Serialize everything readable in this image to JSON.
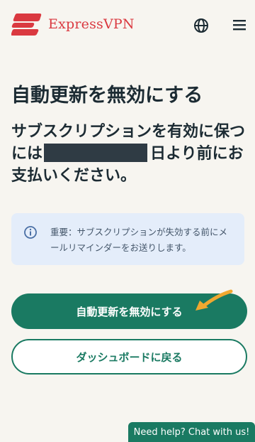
{
  "header": {
    "brand_name": "ExpressVPN",
    "brand_color": "#da3940",
    "icons": [
      "expressvpn-logo-icon",
      "globe-icon",
      "hamburger-menu-icon"
    ]
  },
  "main": {
    "title": "自動更新を無効にする",
    "subtitle_before": "サブスクリプションを有効に保つには",
    "subtitle_after": "日より前にお支払いください。",
    "info_text": "重要：サブスクリプションが失効する前にメールリマインダーをお送りします。"
  },
  "actions": {
    "disable_auto_renew_label": "自動更新を無効にする",
    "back_to_dashboard_label": "ダッシュボードに戻る"
  },
  "chat": {
    "label": "Need help? Chat with us!"
  },
  "colors": {
    "accent": "#1a7a62",
    "background": "#f7f5f0",
    "info_background": "#e4edfa",
    "annotation_arrow": "#f0a830"
  }
}
